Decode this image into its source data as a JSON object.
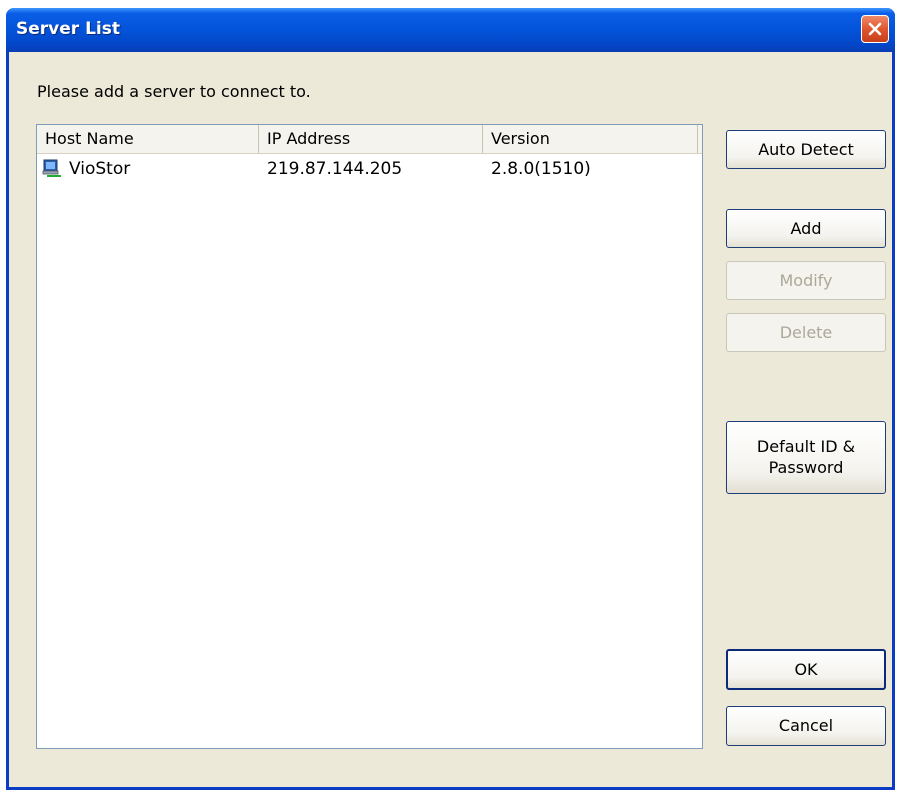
{
  "window": {
    "title": "Server List"
  },
  "prompt": "Please add a server to connect to.",
  "list": {
    "columns": [
      "Host Name",
      "IP Address",
      "Version"
    ],
    "rows": [
      {
        "host_name": "VioStor",
        "ip_address": "219.87.144.205",
        "version": "2.8.0(1510)",
        "icon": "server-computer-icon"
      }
    ]
  },
  "buttons": {
    "auto_detect": "Auto Detect",
    "add": "Add",
    "modify": "Modify",
    "delete": "Delete",
    "default_id_line1": "Default ID &",
    "default_id_line2": "Password",
    "ok": "OK",
    "cancel": "Cancel"
  },
  "states": {
    "modify_disabled": true,
    "delete_disabled": true
  },
  "colors": {
    "titlebar": "#0453d9",
    "dialog_bg": "#ece9d8",
    "close_button": "#e0562e",
    "disabled_text": "#aca899"
  }
}
